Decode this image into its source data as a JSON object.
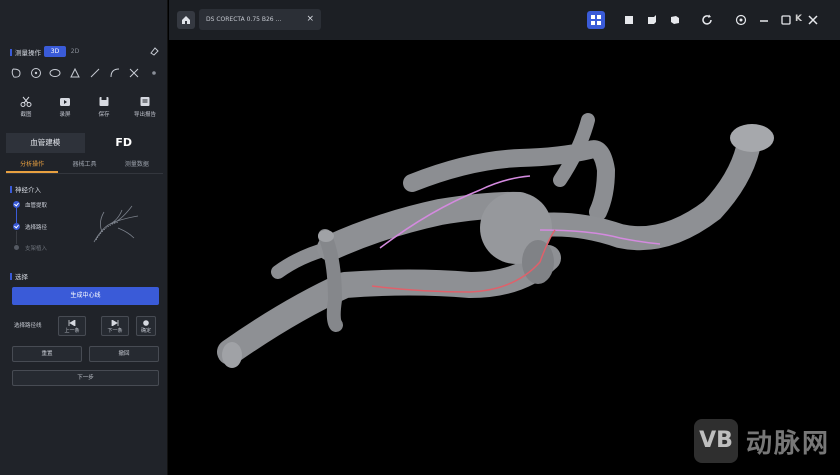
{
  "left_panel": {
    "measure_title": "测量操作",
    "mode_3d": "3D",
    "mode_2d": "2D",
    "big_tools": [
      {
        "icon": "scissors-icon",
        "label": "截图"
      },
      {
        "icon": "video-icon",
        "label": "录屏"
      },
      {
        "icon": "save-icon",
        "label": "保存"
      },
      {
        "icon": "report-icon",
        "label": "导出报告"
      }
    ],
    "main_tabs": {
      "vessel": "血管建模",
      "fd": "FD"
    },
    "sub_tabs": [
      "分析操作",
      "器械工具",
      "测量数据"
    ],
    "path_section": "神经介入",
    "steps": [
      "血管提取",
      "选择路径",
      "支架植入"
    ],
    "select_section": "选择",
    "generate_button": "生成中心线",
    "path_select_label": "选择路径线",
    "nav": {
      "prev": "上一条",
      "next": "下一条",
      "confirm": "确定"
    },
    "reset_button": "重置",
    "undo_button": "撤回",
    "next_step_button": "下一步"
  },
  "topbar": {
    "file_tab": "DS CORECTA  0.75 B26 ...",
    "file_tab_close": "×",
    "corner_mark": "K"
  },
  "watermark": {
    "logo": "VB",
    "text": "动脉网"
  },
  "colors": {
    "accent": "#3a5bd8",
    "orange": "#e8a040",
    "centerline_pink": "#d48adf",
    "centerline_red": "#e0606a"
  }
}
